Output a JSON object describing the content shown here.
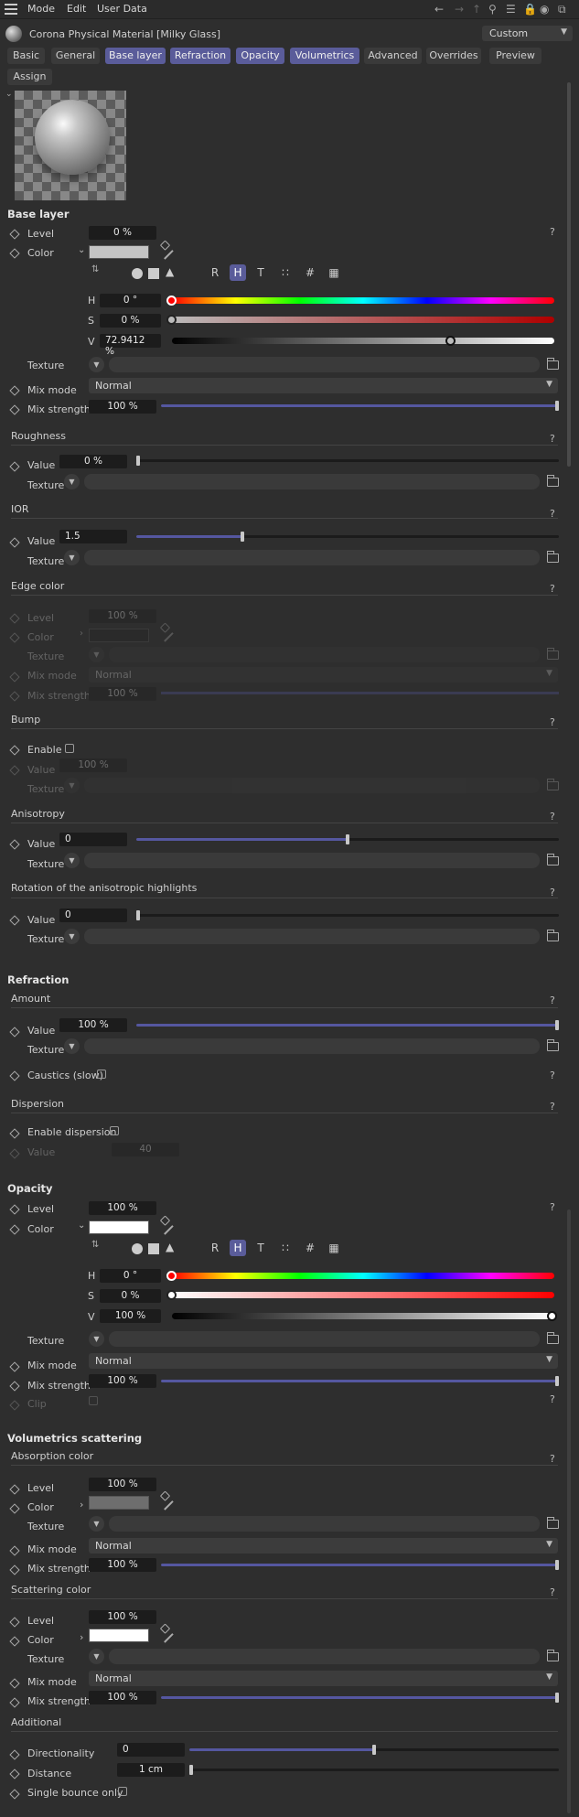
{
  "menubar": {
    "items": [
      "Mode",
      "Edit",
      "User Data"
    ]
  },
  "titlebar": {
    "title": "Corona Physical Material [Milky Glass]",
    "preset": "Custom"
  },
  "tabs": [
    {
      "label": "Basic",
      "active": false
    },
    {
      "label": "General",
      "active": false
    },
    {
      "label": "Base layer",
      "active": true
    },
    {
      "label": "Refraction",
      "active": true
    },
    {
      "label": "Opacity",
      "active": true
    },
    {
      "label": "Volumetrics",
      "active": true
    },
    {
      "label": "Advanced",
      "active": false
    },
    {
      "label": "Overrides",
      "active": false
    },
    {
      "label": "Preview",
      "active": false
    },
    {
      "label": "Assign",
      "active": false
    }
  ],
  "labels": {
    "level": "Level",
    "color": "Color",
    "texture": "Texture",
    "mix_mode": "Mix mode",
    "mix_strength": "Mix strength",
    "value": "Value",
    "enable": "Enable",
    "h": "H",
    "s": "S",
    "v": "V",
    "help": "?"
  },
  "color_modes": [
    "R",
    "H",
    "T",
    "∷",
    "#",
    "▦"
  ],
  "base_layer": {
    "title": "Base layer",
    "level": "0 %",
    "color": {
      "swatch": "#c4c4c4",
      "h": "0 °",
      "s": "0 %",
      "v": "72.9412 %",
      "h_frac": 0,
      "s_frac": 0,
      "v_frac": 0.729
    },
    "mix_mode": "Normal",
    "mix_strength": "100 %",
    "mix_strength_frac": 1.0,
    "roughness": {
      "title": "Roughness",
      "value": "0 %",
      "frac": 0
    },
    "ior": {
      "title": "IOR",
      "value": "1.5",
      "frac": 0.25
    },
    "edge_color": {
      "title": "Edge color",
      "level": "100 %",
      "mix_mode": "Normal",
      "mix_strength": "100 %"
    },
    "bump": {
      "title": "Bump",
      "value": "100 %"
    },
    "anisotropy": {
      "title": "Anisotropy",
      "value": "0",
      "frac": 0.5
    },
    "rotation": {
      "title": "Rotation of the anisotropic highlights",
      "value": "0",
      "frac": 0
    }
  },
  "refraction": {
    "title": "Refraction",
    "amount_title": "Amount",
    "value": "100 %",
    "frac": 1.0,
    "caustics": "Caustics (slow)",
    "dispersion": {
      "title": "Dispersion",
      "enable": "Enable dispersion",
      "value": "40"
    }
  },
  "opacity": {
    "title": "Opacity",
    "level": "100 %",
    "color": {
      "swatch": "#ffffff",
      "h": "0 °",
      "s": "0 %",
      "v": "100 %",
      "h_frac": 0,
      "s_frac": 0,
      "v_frac": 1.0
    },
    "mix_mode": "Normal",
    "mix_strength": "100 %",
    "mix_strength_frac": 1.0,
    "clip": "Clip"
  },
  "volumetrics": {
    "title": "Volumetrics scattering",
    "absorption": {
      "title": "Absorption color",
      "level": "100 %",
      "swatch": "#6e6e6e",
      "mix_mode": "Normal",
      "mix_strength": "100 %",
      "frac": 1.0
    },
    "scattering": {
      "title": "Scattering color",
      "level": "100 %",
      "swatch": "#ffffff",
      "mix_mode": "Normal",
      "mix_strength": "100 %",
      "frac": 1.0
    },
    "additional": {
      "title": "Additional",
      "directionality_label": "Directionality",
      "directionality": "0",
      "dir_frac": 0.5,
      "distance_label": "Distance",
      "distance": "1 cm",
      "dist_frac": 0,
      "single_bounce": "Single bounce only"
    }
  }
}
